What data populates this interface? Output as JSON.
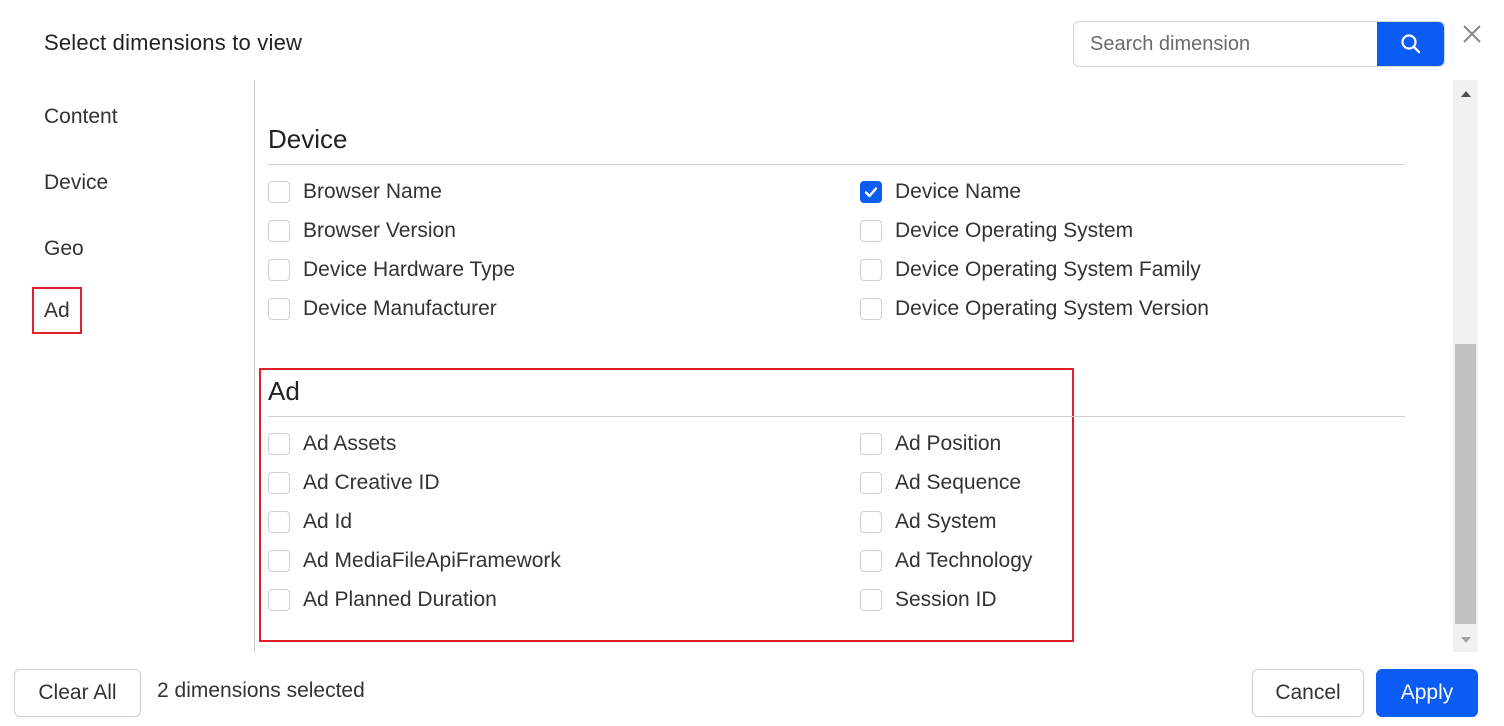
{
  "dialog": {
    "title": "Select dimensions to view"
  },
  "search": {
    "placeholder": "Search dimension",
    "value": ""
  },
  "sidebar": {
    "items": [
      {
        "label": "Content"
      },
      {
        "label": "Device"
      },
      {
        "label": "Geo"
      },
      {
        "label": "Ad"
      }
    ]
  },
  "sections": {
    "device": {
      "title": "Device",
      "left": [
        {
          "label": "Browser Name",
          "checked": false
        },
        {
          "label": "Browser Version",
          "checked": false
        },
        {
          "label": "Device Hardware Type",
          "checked": false
        },
        {
          "label": "Device Manufacturer",
          "checked": false
        }
      ],
      "right": [
        {
          "label": "Device Name",
          "checked": true
        },
        {
          "label": "Device Operating System",
          "checked": false
        },
        {
          "label": "Device Operating System Family",
          "checked": false
        },
        {
          "label": "Device Operating System Version",
          "checked": false
        }
      ]
    },
    "ad": {
      "title": "Ad",
      "left": [
        {
          "label": "Ad Assets",
          "checked": false
        },
        {
          "label": "Ad Creative ID",
          "checked": false
        },
        {
          "label": "Ad Id",
          "checked": false
        },
        {
          "label": "Ad MediaFileApiFramework",
          "checked": false
        },
        {
          "label": "Ad Planned Duration",
          "checked": false
        }
      ],
      "right": [
        {
          "label": "Ad Position",
          "checked": false
        },
        {
          "label": "Ad Sequence",
          "checked": false
        },
        {
          "label": "Ad System",
          "checked": false
        },
        {
          "label": "Ad Technology",
          "checked": false
        },
        {
          "label": "Session ID",
          "checked": false
        }
      ]
    }
  },
  "footer": {
    "clear_all_label": "Clear All",
    "status_text": "2 dimensions selected",
    "cancel_label": "Cancel",
    "apply_label": "Apply"
  },
  "colors": {
    "accent": "#0a5cf5",
    "highlight": "#e0202a"
  }
}
